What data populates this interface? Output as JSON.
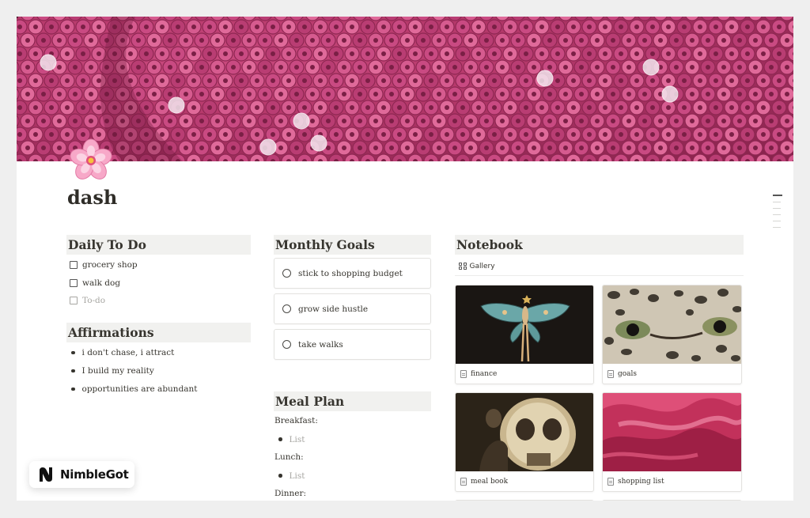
{
  "page": {
    "title": "dash",
    "icon": "cherry-blossom-icon"
  },
  "columns": {
    "daily_todo": {
      "heading": "Daily To Do",
      "items": [
        "grocery shop",
        "walk dog"
      ],
      "placeholder": "To-do"
    },
    "affirmations": {
      "heading": "Affirmations",
      "items": [
        "i don't chase, i attract",
        "I build my reality",
        "opportunities are abundant"
      ]
    },
    "monthly_goals": {
      "heading": "Monthly Goals",
      "items": [
        "stick to shopping budget",
        "grow side hustle",
        "take walks"
      ]
    },
    "meal_plan": {
      "heading": "Meal Plan",
      "breakfast_label": "Breakfast:",
      "breakfast_list": "List",
      "lunch_label": "Lunch:",
      "lunch_list": "List",
      "dinner_label": "Dinner:"
    },
    "notebook": {
      "heading": "Notebook",
      "view_label": "Gallery",
      "cards": [
        "finance",
        "goals",
        "meal book",
        "shopping list"
      ]
    }
  },
  "watermark": {
    "brand": "NimbleGot"
  },
  "colors": {
    "cover_pink": "#b73a6c",
    "heading_bg": "#f1f1ef",
    "text": "#37352f",
    "placeholder": "#a7a6a2"
  }
}
